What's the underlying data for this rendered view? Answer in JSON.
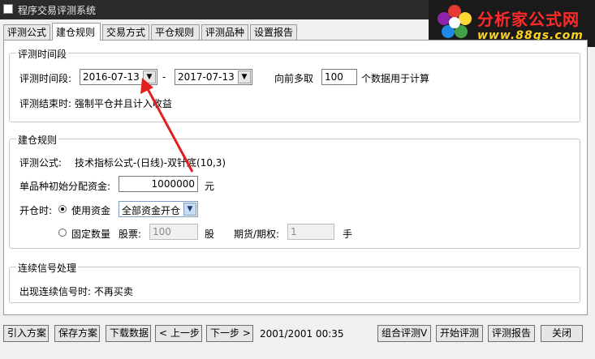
{
  "window": {
    "title": "程序交易评测系统"
  },
  "logo": {
    "brand": "分析家公式网",
    "url": "www.88gs.com"
  },
  "tabs": [
    "评测公式",
    "建仓规则",
    "交易方式",
    "平仓规则",
    "评测品种",
    "设置报告"
  ],
  "active_tab": 1,
  "period_group": {
    "title": "评测时间段",
    "label": "评测时间段:",
    "start_date": "2016-07-13",
    "dash": "-",
    "end_date": "2017-07-13",
    "lookback_prefix": "向前多取",
    "lookback_value": "100",
    "lookback_suffix": "个数据用于计算",
    "end_note": "评测结束时: 强制平仓并且计入收益"
  },
  "build_group": {
    "title": "建仓规则",
    "formula_label": "评测公式:",
    "formula_value": "技术指标公式-(日线)-双针底(10,3)",
    "capital_label": "单品种初始分配资金:",
    "capital_value": "1000000",
    "capital_unit": "元",
    "open_label": "开仓时:",
    "use_funds_label": "使用资金",
    "funds_option": "全部资金开仓",
    "fixed_qty_label": "固定数量",
    "stock_label": "股票:",
    "stock_value": "100",
    "stock_unit": "股",
    "futures_label": "期货/期权:",
    "futures_value": "1",
    "futures_unit": "手"
  },
  "signal_group": {
    "title": "连续信号处理",
    "note": "出现连续信号时: 不再买卖"
  },
  "footer": {
    "import_btn": "引入方案",
    "save_btn": "保存方案",
    "download_btn": "下载数据",
    "prev_btn": "< 上一步",
    "next_btn": "下一步 >",
    "status": "2001/2001 00:35",
    "combo_btn": "组合评测V",
    "start_btn": "开始评测",
    "report_btn": "评测报告",
    "close_btn": "关闭"
  },
  "colors": {
    "annotation_arrow": "#e02020",
    "brand": "#ff2a2a",
    "url": "#ffd21e"
  }
}
